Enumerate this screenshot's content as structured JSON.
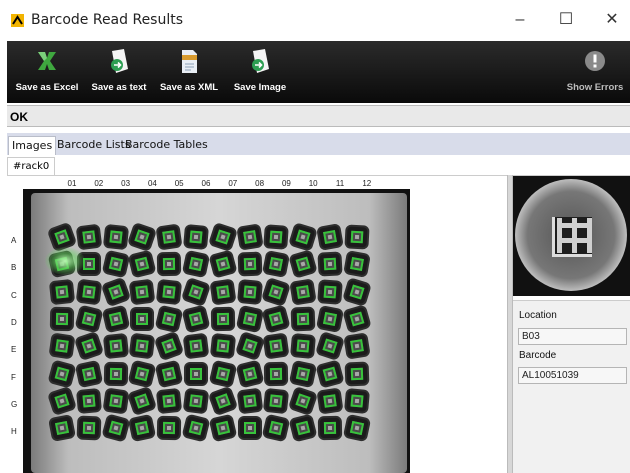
{
  "window": {
    "title": "Barcode Read Results",
    "minimize": "–",
    "maximize": "☐",
    "close": "✕"
  },
  "toolbar": {
    "save_excel": "Save as Excel",
    "save_text": "Save as text",
    "save_xml": "Save as XML",
    "save_image": "Save Image",
    "show_errors": "Show Errors"
  },
  "status": {
    "text": "OK"
  },
  "tabs": [
    "Images",
    "Barcode Lists",
    "Barcode Tables"
  ],
  "subtab": "#rack0",
  "rack": {
    "columns": [
      "01",
      "02",
      "03",
      "04",
      "05",
      "06",
      "07",
      "08",
      "09",
      "10",
      "11",
      "12"
    ],
    "rows": [
      "A",
      "B",
      "C",
      "D",
      "E",
      "F",
      "G",
      "H"
    ]
  },
  "details": {
    "location_label": "Location",
    "location_value": "B03",
    "barcode_label": "Barcode",
    "barcode_value": "AL10051039"
  },
  "colors": {
    "toolbar_bg": "#1a1a1a",
    "read_ok_green": "#38c33c",
    "app_icon": "#f2b400"
  }
}
